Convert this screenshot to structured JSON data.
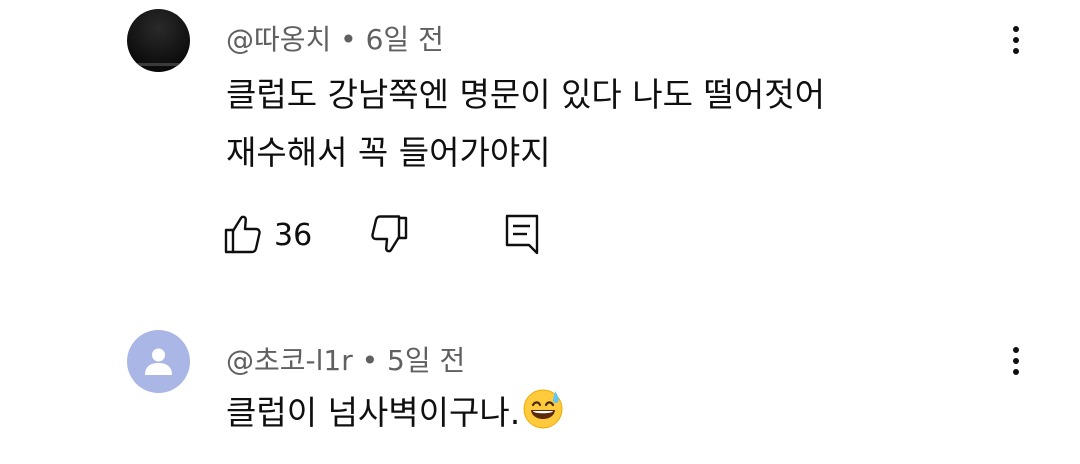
{
  "comments": [
    {
      "meta": "@따옹치 • 6일 전",
      "line1": "클럽도 강남쪽엔 명문이 있다 나도 떨어젓어",
      "line2": "재수해서 꼭 들어가야지",
      "like_count": "36",
      "avatar": "dark-avatar"
    },
    {
      "meta": "@초코-l1r • 5일 전",
      "line1": "클럽이 넘사벽이구나.",
      "emoji": "grinning-sweat-emoji",
      "avatar": "default-person-avatar"
    }
  ],
  "icons": {
    "like": "thumbs-up-icon",
    "dislike": "thumbs-down-icon",
    "reply": "reply-comment-icon",
    "more": "more-vertical-icon"
  },
  "colors": {
    "text": "#0f0f0f",
    "meta": "#606060",
    "avatar_default_bg": "#a9b6e6"
  }
}
